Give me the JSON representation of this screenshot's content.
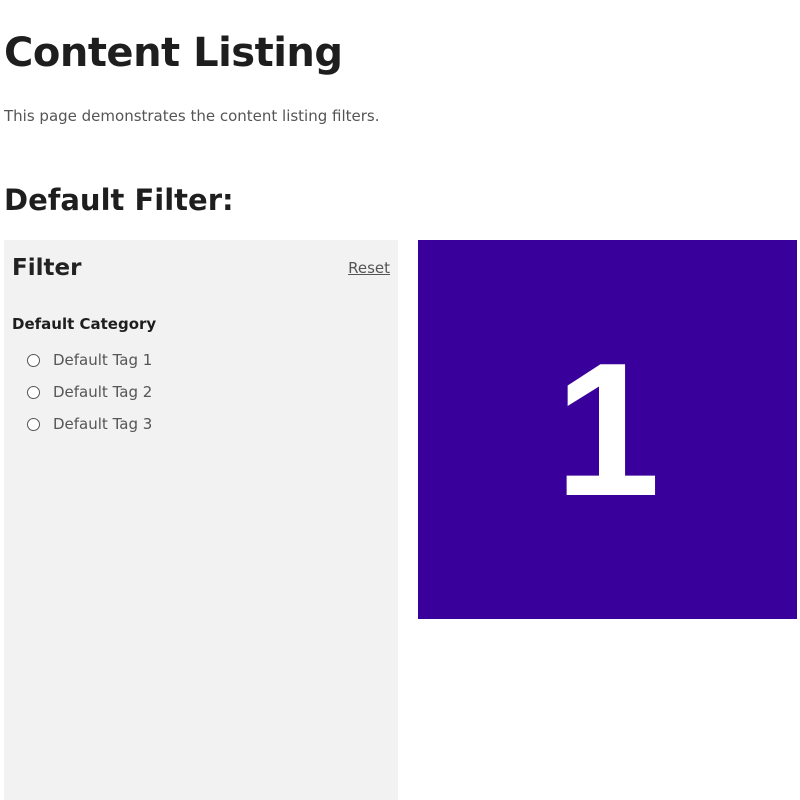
{
  "page": {
    "title": "Content Listing",
    "description": "This page demonstrates the content listing filters."
  },
  "section": {
    "title": "Default Filter:"
  },
  "filter": {
    "heading": "Filter",
    "reset_label": "Reset",
    "category": {
      "label": "Default Category",
      "tags": [
        {
          "label": "Default Tag 1",
          "selected": false
        },
        {
          "label": "Default Tag 2",
          "selected": false
        },
        {
          "label": "Default Tag 3",
          "selected": false
        }
      ]
    }
  },
  "results": {
    "items": [
      {
        "label": "1",
        "color": "#3a009b"
      }
    ]
  },
  "colors": {
    "panel_bg": "#f2f2f2",
    "card_bg": "#3a009b"
  }
}
